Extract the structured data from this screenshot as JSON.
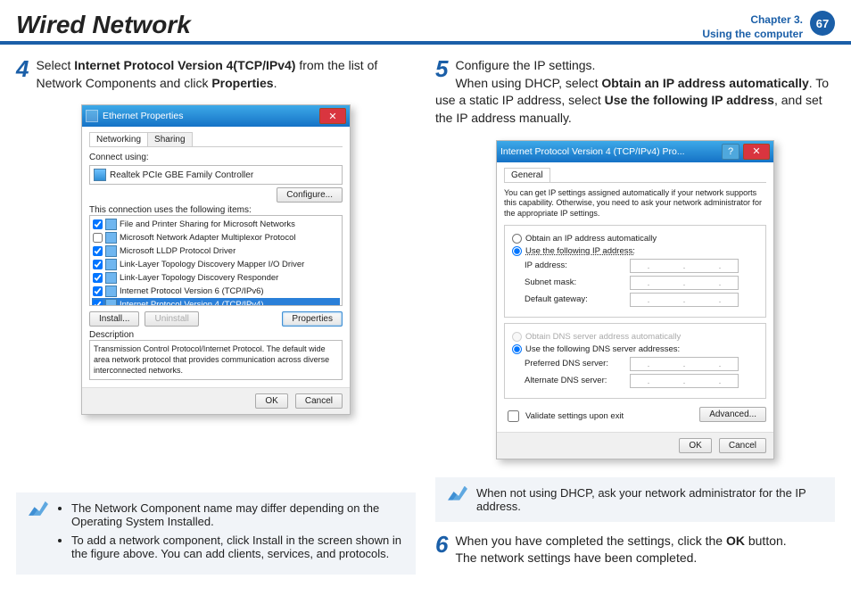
{
  "header": {
    "title": "Wired Network",
    "chapter_line1": "Chapter 3.",
    "chapter_line2": "Using the computer",
    "page_number": "67"
  },
  "left": {
    "step4_num": "4",
    "step4_text_pre": "Select ",
    "step4_bold1": "Internet Protocol Version 4(TCP/IPv4)",
    "step4_text_mid": " from the list of Network Components and click ",
    "step4_bold2": "Properties",
    "step4_text_end": ".",
    "dlg": {
      "title": "Ethernet Properties",
      "tab1": "Networking",
      "tab2": "Sharing",
      "connect_label": "Connect using:",
      "adapter": "Realtek PCIe GBE Family Controller",
      "configure_btn": "Configure...",
      "items_label": "This connection uses the following items:",
      "item1": "File and Printer Sharing for Microsoft Networks",
      "item2": "Microsoft Network Adapter Multiplexor Protocol",
      "item3": "Microsoft LLDP Protocol Driver",
      "item4": "Link-Layer Topology Discovery Mapper I/O Driver",
      "item5": "Link-Layer Topology Discovery Responder",
      "item6": "Internet Protocol Version 6 (TCP/IPv6)",
      "item7": "Internet Protocol Version 4 (TCP/IPv4)",
      "install_btn": "Install...",
      "uninstall_btn": "Uninstall",
      "properties_btn": "Properties",
      "desc_label": "Description",
      "desc_text": "Transmission Control Protocol/Internet Protocol. The default wide area network protocol that provides communication across diverse interconnected networks.",
      "ok": "OK",
      "cancel": "Cancel"
    },
    "tip1": "The Network Component name may differ depending on the Operating System Installed.",
    "tip2": "To add a network component, click Install in the screen shown in the figure above. You can add clients, services, and protocols."
  },
  "right": {
    "step5_num": "5",
    "step5_line1": "Configure the IP settings.",
    "step5_line2_pre": "When using DHCP, select ",
    "step5_line2_b1": "Obtain an IP address automatically",
    "step5_line2_mid": ". To use a static IP address, select ",
    "step5_line2_b2": "Use the following IP address",
    "step5_line2_end": ", and set the IP address manually.",
    "dlg": {
      "title": "Internet Protocol Version 4 (TCP/IPv4) Pro...",
      "tab1": "General",
      "help_text": "You can get IP settings assigned automatically if your network supports this capability. Otherwise, you need to ask your network administrator for the appropriate IP settings.",
      "radio_auto_ip": "Obtain an IP address automatically",
      "radio_use_ip": "Use the following IP address:",
      "ip_label": "IP address:",
      "subnet_label": "Subnet mask:",
      "gateway_label": "Default gateway:",
      "radio_auto_dns": "Obtain DNS server address automatically",
      "radio_use_dns": "Use the following DNS server addresses:",
      "pref_dns": "Preferred DNS server:",
      "alt_dns": "Alternate DNS server:",
      "validate": "Validate settings upon exit",
      "advanced": "Advanced...",
      "ok": "OK",
      "cancel": "Cancel"
    },
    "tip": "When not using DHCP, ask your network administrator for the IP address.",
    "step6_num": "6",
    "step6_line1_pre": "When you have completed the settings, click the ",
    "step6_line1_b": "OK",
    "step6_line1_end": " button.",
    "step6_line2": "The network settings have been completed."
  }
}
